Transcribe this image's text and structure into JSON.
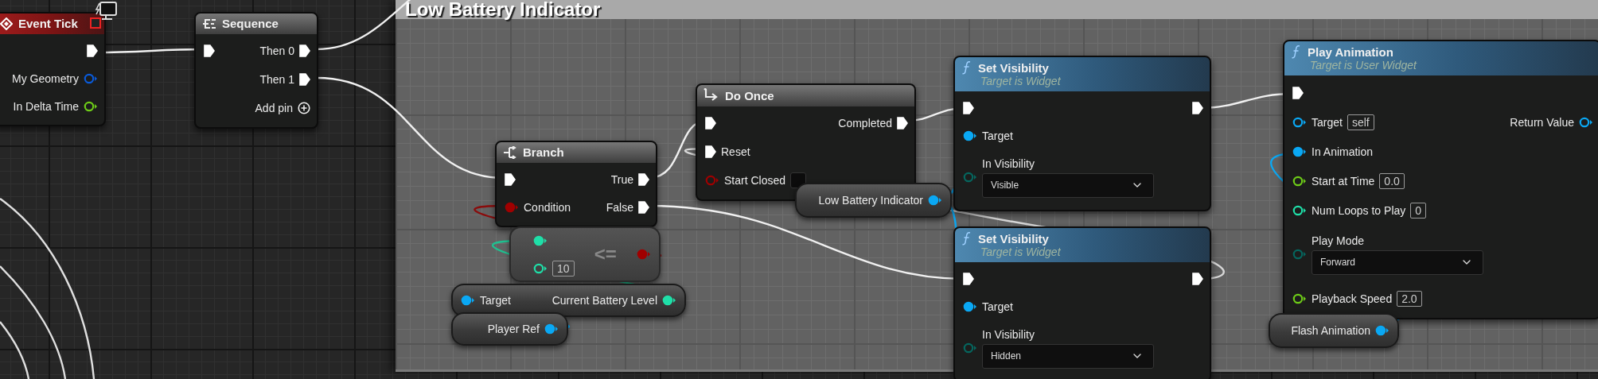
{
  "comment": {
    "title": "Low Battery Indicator"
  },
  "nodes": [
    {
      "kind": "event",
      "title": "Event Tick",
      "rows": [
        {
          "out": {
            "kind": "exec",
            "connected": true
          }
        },
        {
          "out": {
            "kind": "struct",
            "label": "My Geometry",
            "connected": false
          }
        },
        {
          "out": {
            "kind": "float",
            "label": "In Delta Time",
            "connected": false
          }
        }
      ]
    },
    {
      "kind": "sequence",
      "title": "Sequence",
      "add_pin": "Add pin",
      "rows": [
        {
          "in": {
            "kind": "exec",
            "connected": true
          },
          "out": {
            "kind": "exec",
            "label": "Then 0",
            "connected": true
          }
        },
        {
          "out": {
            "kind": "exec",
            "label": "Then 1",
            "connected": true
          }
        }
      ]
    },
    {
      "kind": "branch",
      "title": "Branch",
      "rows": [
        {
          "in": {
            "kind": "exec",
            "connected": true
          },
          "out": {
            "kind": "exec",
            "label": "True",
            "connected": true
          }
        },
        {
          "in": {
            "kind": "bool",
            "label": "Condition",
            "connected": true
          },
          "out": {
            "kind": "exec",
            "label": "False",
            "connected": true
          }
        }
      ]
    },
    {
      "kind": "compact",
      "symbol": "<=",
      "output": {
        "kind": "bool",
        "connected": true
      },
      "rows": [
        {
          "in": {
            "kind": "int",
            "connected": true
          }
        },
        {
          "in": {
            "kind": "int",
            "value": "10",
            "connected": false
          }
        }
      ]
    },
    {
      "kind": "variable",
      "rows": [
        {
          "in": {
            "kind": "object",
            "label": "Target",
            "connected": true
          },
          "out": {
            "kind": "int",
            "label": "Current Battery Level",
            "connected": true
          }
        }
      ]
    },
    {
      "kind": "variable",
      "rows": [
        {
          "out": {
            "kind": "object",
            "label": "Player Ref",
            "connected": true
          }
        }
      ]
    },
    {
      "kind": "do_once",
      "title": "Do Once",
      "rows": [
        {
          "in": {
            "kind": "exec",
            "connected": true
          },
          "out": {
            "kind": "exec",
            "label": "Completed",
            "connected": true
          }
        },
        {
          "in": {
            "kind": "exec",
            "label": "Reset",
            "connected": true
          }
        },
        {
          "in": {
            "kind": "bool",
            "label": "Start Closed",
            "connected": false,
            "checked": false
          }
        }
      ]
    },
    {
      "kind": "variable",
      "rows": [
        {
          "out": {
            "kind": "object",
            "label": "Low Battery Indicator",
            "connected": true
          }
        }
      ]
    },
    {
      "kind": "function",
      "title": "Set Visibility",
      "subtitle": "Target is Widget",
      "rows": [
        {
          "in": {
            "kind": "exec",
            "connected": true
          },
          "out": {
            "kind": "exec",
            "connected": true
          }
        },
        {
          "in": {
            "kind": "object",
            "label": "Target",
            "connected": true
          }
        },
        {
          "in": {
            "kind": "enum",
            "label": "In Visibility",
            "value": "Visible",
            "connected": false
          }
        }
      ]
    },
    {
      "kind": "function",
      "title": "Set Visibility",
      "subtitle": "Target is Widget",
      "rows": [
        {
          "in": {
            "kind": "exec",
            "connected": true
          },
          "out": {
            "kind": "exec",
            "connected": true
          }
        },
        {
          "in": {
            "kind": "object",
            "label": "Target",
            "connected": true
          }
        },
        {
          "in": {
            "kind": "enum",
            "label": "In Visibility",
            "value": "Hidden",
            "connected": false
          }
        }
      ]
    },
    {
      "kind": "function",
      "title": "Play Animation",
      "subtitle": "Target is User Widget",
      "rows": [
        {
          "in": {
            "kind": "exec",
            "connected": true
          }
        },
        {
          "in": {
            "kind": "object",
            "label": "Target",
            "value": "self",
            "connected": false
          },
          "out": {
            "kind": "object",
            "label": "Return Value",
            "connected": false
          }
        },
        {
          "in": {
            "kind": "object",
            "label": "In Animation",
            "connected": true
          }
        },
        {
          "in": {
            "kind": "float",
            "label": "Start at Time",
            "value": "0.0",
            "connected": false
          }
        },
        {
          "in": {
            "kind": "int",
            "label": "Num Loops to Play",
            "value": "0",
            "connected": false
          }
        },
        {
          "in": {
            "kind": "enum",
            "label": "Play Mode",
            "value": "Forward",
            "connected": false
          }
        },
        {
          "in": {
            "kind": "float",
            "label": "Playback Speed",
            "value": "2.0",
            "connected": false
          }
        }
      ]
    },
    {
      "kind": "variable",
      "rows": [
        {
          "out": {
            "kind": "object",
            "label": "Flash Animation",
            "connected": true
          }
        }
      ]
    }
  ]
}
